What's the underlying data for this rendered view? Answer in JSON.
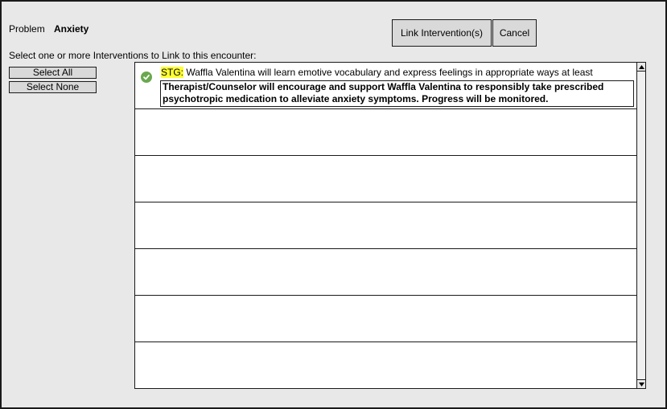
{
  "problem": {
    "label": "Problem",
    "value": "Anxiety"
  },
  "toolbar": {
    "link_label": "Link Intervention(s)",
    "cancel_label": "Cancel"
  },
  "instructions": "Select one or more Interventions to Link to this encounter:",
  "selection": {
    "select_all_label": "Select All",
    "select_none_label": "Select None"
  },
  "interventions": [
    {
      "selected": true,
      "tag": "STG:",
      "goal": " Waffla Valentina will learn emotive vocabulary and express feelings in appropriate ways at least",
      "detail": "Therapist/Counselor will encourage and support Waffla Valentina to responsibly take prescribed psychotropic medication to alleviate anxiety symptoms. Progress will be monitored."
    }
  ],
  "icons": {
    "check": "check-circle-icon",
    "scroll_up": "arrow-up-icon",
    "scroll_down": "arrow-down-icon"
  },
  "colors": {
    "tag_highlight": "#ffff33",
    "check": "#6aa84f",
    "background": "#e8e8e8"
  }
}
